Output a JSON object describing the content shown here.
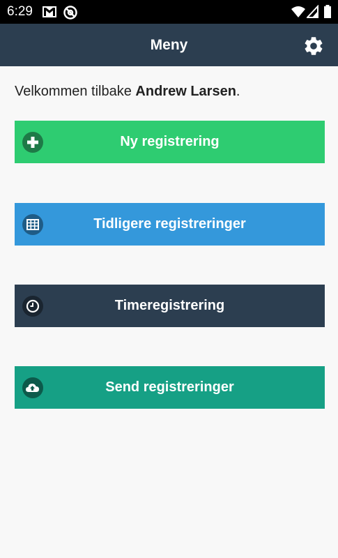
{
  "status_bar": {
    "time": "6:29"
  },
  "app_bar": {
    "title": "Meny"
  },
  "welcome": {
    "prefix": "Velkommen tilbake ",
    "name": "Andrew Larsen",
    "suffix": "."
  },
  "menu": {
    "new_registration": "Ny registrering",
    "previous_registrations": "Tidligere registreringer",
    "time_registration": "Timeregistrering",
    "send_registrations": "Send registreringer"
  },
  "colors": {
    "app_bar": "#2c3e50",
    "green": "#2ecc71",
    "blue": "#3498db",
    "dark": "#2c3e50",
    "teal": "#16a085"
  },
  "icons": [
    "gmail-icon",
    "at-sign-icon",
    "wifi-icon",
    "signal-icon",
    "battery-icon",
    "gear-icon",
    "plus-circle-icon",
    "table-icon",
    "clock-icon",
    "cloud-upload-icon"
  ]
}
